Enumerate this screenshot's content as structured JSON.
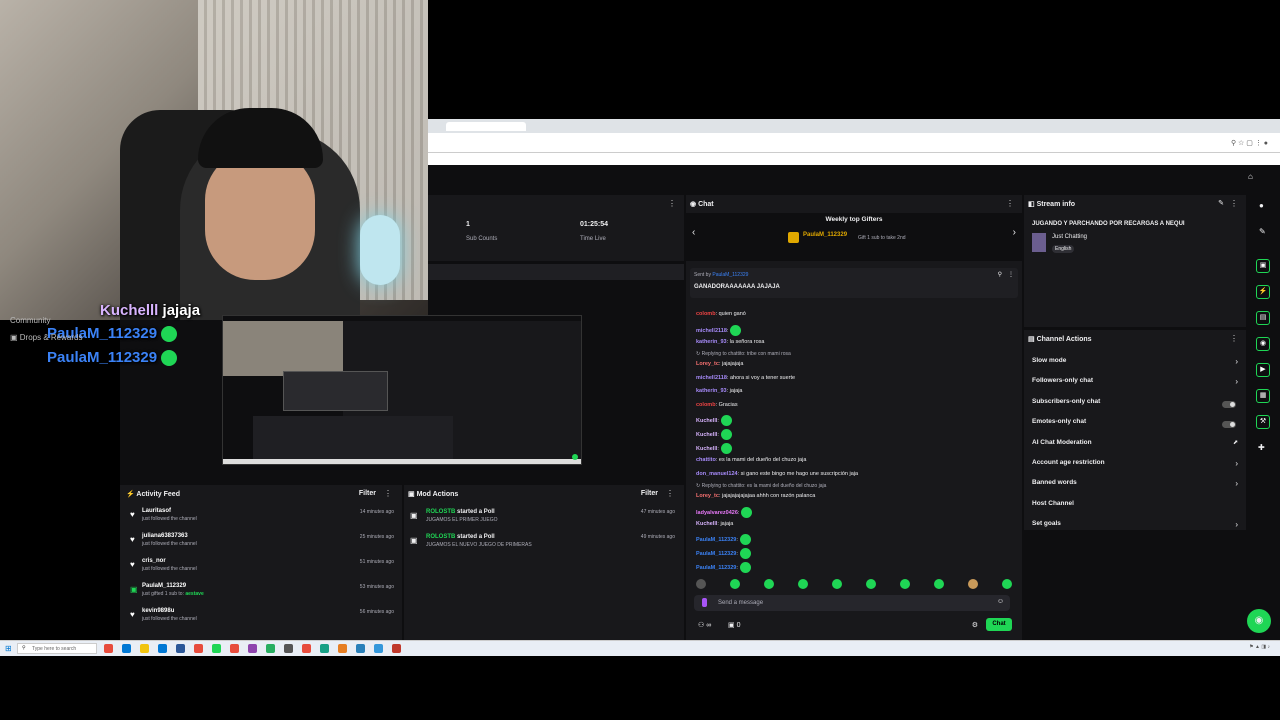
{
  "webcam": {
    "overlay_lines": [
      {
        "user": "Kuchelll",
        "user_color": "#d8b4fe",
        "text": "jajaja"
      },
      {
        "user": "PaulaM_112329",
        "user_color": "#3b82f6",
        "text": ""
      },
      {
        "user": "PaulaM_112329",
        "user_color": "#3b82f6",
        "text": ""
      }
    ]
  },
  "left_menu": {
    "items": [
      "Community",
      "Drops & Rewards"
    ]
  },
  "dashboard": {
    "stats": [
      {
        "value": "1",
        "label": "Sub Counts"
      },
      {
        "value": "01:25:54",
        "label": "Time Live"
      }
    ],
    "activity_feed": {
      "title": "Activity Feed",
      "filter_label": "Filter",
      "items": [
        {
          "name": "Lauritasof",
          "detail": "just followed the channel",
          "highlight": "",
          "time": "14 minutes ago",
          "icon": "heart-icon"
        },
        {
          "name": "juliana63837363",
          "detail": "just followed the channel",
          "highlight": "",
          "time": "25 minutes ago",
          "icon": "heart-icon"
        },
        {
          "name": "cris_nor",
          "detail": "just followed the channel",
          "highlight": "",
          "time": "51 minutes ago",
          "icon": "heart-icon"
        },
        {
          "name": "PaulaM_112329",
          "detail": "just gifted 1 sub to:",
          "highlight": "aestave",
          "time": "53 minutes ago",
          "icon": "gift-icon"
        },
        {
          "name": "kevin9898u",
          "detail": "just followed the channel",
          "highlight": "",
          "time": "56 minutes ago",
          "icon": "heart-icon"
        }
      ]
    },
    "mod_actions": {
      "title": "Mod Actions",
      "filter_label": "Filter",
      "items": [
        {
          "name": "ROLOSTB",
          "action": "started a Poll",
          "detail": "JUGAMOS EL PRIMER JUEGO",
          "time": "47 minutes ago"
        },
        {
          "name": "ROLOSTB",
          "action": "started a Poll",
          "detail": "JUGAMOS EL NUEVO JUEGO DE PRIMERAS",
          "time": "49 minutes ago"
        }
      ]
    },
    "chat": {
      "title": "Chat",
      "top_gifters_title": "Weekly top Gifters",
      "top_gifter_name": "PaulaM_112329",
      "top_gifter_note": "Gift 1 sub to take 2nd",
      "pinned_by_label": "Sent by",
      "pinned_by_user": "PaulaM_112329",
      "pinned_message": "GANADORAAAAAAA JAJAJA",
      "lines": [
        {
          "type": "msg",
          "user": "colomb",
          "color": "#ef4444",
          "text": ": quien ganó"
        },
        {
          "type": "msg",
          "user": "michell2118",
          "color": "#a78bfa",
          "text": ":"
        },
        {
          "type": "msg",
          "user": "katherin_93",
          "color": "#a78bfa",
          "text": ": la señora rosa"
        },
        {
          "type": "reply",
          "text": "Replying to chattito: tribe con mami rosa"
        },
        {
          "type": "msg",
          "user": "Lorey_tc",
          "color": "#f87171",
          "text": ": jajajajaja"
        },
        {
          "type": "msg",
          "user": "michell2118",
          "color": "#a78bfa",
          "text": ": ahora si voy a tener suerte"
        },
        {
          "type": "msg",
          "user": "katherin_93",
          "color": "#a78bfa",
          "text": ": jajaja"
        },
        {
          "type": "msg",
          "user": "colomb",
          "color": "#ef4444",
          "text": ": Gracias"
        },
        {
          "type": "msg",
          "user": "Kuchelll",
          "color": "#d8b4fe",
          "text": ":"
        },
        {
          "type": "msg",
          "user": "Kuchelll",
          "color": "#d8b4fe",
          "text": ":"
        },
        {
          "type": "msg",
          "user": "Kuchelll",
          "color": "#d8b4fe",
          "text": ":"
        },
        {
          "type": "msg",
          "user": "chattito",
          "color": "#a78bfa",
          "text": ": es la mami del dueño del chuzo jaja"
        },
        {
          "type": "msg",
          "user": "don_manuel124",
          "color": "#a78bfa",
          "text": ": si gano este bingo me hago une suscripción jaja"
        },
        {
          "type": "reply",
          "text": "Replying to chattito: es la mami del dueño del chuzo jaja"
        },
        {
          "type": "msg",
          "user": "Lorey_tc",
          "color": "#f87171",
          "text": ": jajajajajajajaa ahhh con razón palanca"
        },
        {
          "type": "msg",
          "user": "ladyalvarez0426",
          "color": "#e879f9",
          "text": ":"
        },
        {
          "type": "msg",
          "user": "Kuchelll",
          "color": "#d8b4fe",
          "text": ": jajaja"
        },
        {
          "type": "msg",
          "user": "PaulaM_112329",
          "color": "#3b82f6",
          "text": ":"
        },
        {
          "type": "msg",
          "user": "PaulaM_112329",
          "color": "#3b82f6",
          "text": ":"
        },
        {
          "type": "msg",
          "user": "PaulaM_112329",
          "color": "#3b82f6",
          "text": ":"
        }
      ],
      "input_placeholder": "Send a message",
      "points_value": "0",
      "send_label": "Chat"
    },
    "stream_info": {
      "title": "Stream info",
      "stream_title": "JUGANDO Y PARCHANDO POR RECARGAS A NEQUI",
      "category": "Just Chatting",
      "tag": "English"
    },
    "channel_actions": {
      "title": "Channel Actions",
      "items": [
        {
          "label": "Slow mode",
          "control": "chevron"
        },
        {
          "label": "Followers-only chat",
          "control": "chevron"
        },
        {
          "label": "Subscribers-only chat",
          "control": "toggle"
        },
        {
          "label": "Emotes-only chat",
          "control": "toggle"
        },
        {
          "label": "AI Chat Moderation",
          "control": "external"
        },
        {
          "label": "Account age restriction",
          "control": "chevron"
        },
        {
          "label": "Banned words",
          "control": "chevron"
        },
        {
          "label": "Host Channel",
          "control": "none"
        },
        {
          "label": "Set goals",
          "control": "chevron"
        }
      ]
    }
  },
  "taskbar": {
    "search_placeholder": "Type here to search"
  },
  "colors": {
    "kick_green": "#53fc18",
    "accent_green": "#1fd655",
    "panel_bg": "#18181b",
    "page_bg": "#0e0e10"
  }
}
